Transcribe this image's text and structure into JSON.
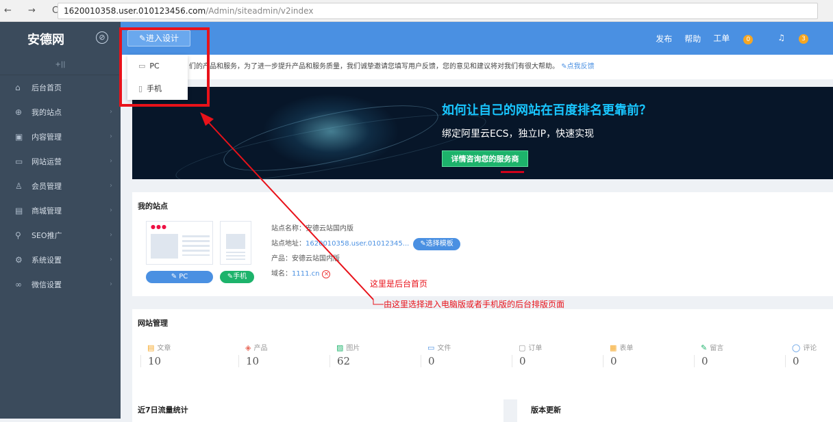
{
  "browser": {
    "nav_glyphs": "← → C",
    "url_host": "1620010358.user.010123456.com",
    "url_path": "/Admin/siteadmin/v2index"
  },
  "topbar": {
    "logo": "安德网",
    "design_button": "进入设计",
    "publish": "发布",
    "help": "帮助",
    "ticket": "工单",
    "ticket_count": "0",
    "notify_count": "3"
  },
  "dropdown": {
    "pc": "PC",
    "mobile": "手机"
  },
  "sidebar": {
    "collapse": "+||",
    "items": [
      {
        "icon": "⌂",
        "label": "后台首页",
        "arrow": ""
      },
      {
        "icon": "⊕",
        "label": "我的站点",
        "arrow": "›"
      },
      {
        "icon": "▣",
        "label": "内容管理",
        "arrow": "›"
      },
      {
        "icon": "▭",
        "label": "网站运营",
        "arrow": "›"
      },
      {
        "icon": "♙",
        "label": "会员管理",
        "arrow": "›"
      },
      {
        "icon": "▤",
        "label": "商城管理",
        "arrow": "›"
      },
      {
        "icon": "⚲",
        "label": "SEO推广",
        "arrow": "›"
      },
      {
        "icon": "⚙",
        "label": "系统设置",
        "arrow": "›"
      },
      {
        "icon": "∞",
        "label": "微信设置",
        "arrow": "›"
      }
    ]
  },
  "notice": {
    "text": "们的产品和服务，为了进一步提升产品和服务质量，我们诚挚邀请您填写用户反馈，您的意见和建议将对我们有很大帮助。",
    "feedback_link": "点我反馈"
  },
  "banner": {
    "headline": "如何让自己的网站在百度排名更靠前？",
    "subline": "绑定阿里云ECS，独立IP，快速实现",
    "cta": "详情咨询您的服务商"
  },
  "my_site": {
    "title": "我的站点",
    "name_label": "站点名称：安德云站国内版",
    "address_label": "站点地址：",
    "address_value": "1620010358.user.01012345...",
    "template_button": "选择模板",
    "product_label": "产品：安德云站国内版",
    "domain_label": "域名：",
    "domain_value": "1111.cn",
    "pc_button": "PC",
    "mobile_button": "手机"
  },
  "site_mgmt": {
    "title": "网站管理",
    "stats": [
      {
        "icon": "▤",
        "color": "#f5a623",
        "label": "文章",
        "value": "10"
      },
      {
        "icon": "◈",
        "color": "#e86a5b",
        "label": "产品",
        "value": "10"
      },
      {
        "icon": "▨",
        "color": "#1db36b",
        "label": "图片",
        "value": "62"
      },
      {
        "icon": "▭",
        "color": "#4a90e2",
        "label": "文件",
        "value": "0"
      },
      {
        "icon": "▢",
        "color": "#999999",
        "label": "订单",
        "value": "0"
      },
      {
        "icon": "▦",
        "color": "#f5a623",
        "label": "表单",
        "value": "0"
      },
      {
        "icon": "✎",
        "color": "#1db36b",
        "label": "留言",
        "value": "0"
      },
      {
        "icon": "◯",
        "color": "#4a90e2",
        "label": "评论",
        "value": "0"
      }
    ]
  },
  "traffic": {
    "title": "近7日流量统计"
  },
  "version": {
    "title": "版本更新"
  },
  "annotations": {
    "home_note": "这里是后台首页",
    "select_note": "由这里选择进入电脑版或者手机版的后台排版页面"
  },
  "colors": {
    "accent": "#4a90e2",
    "sidebar": "#3b4b5c",
    "annotation": "#e8121a",
    "success": "#1db36b"
  }
}
